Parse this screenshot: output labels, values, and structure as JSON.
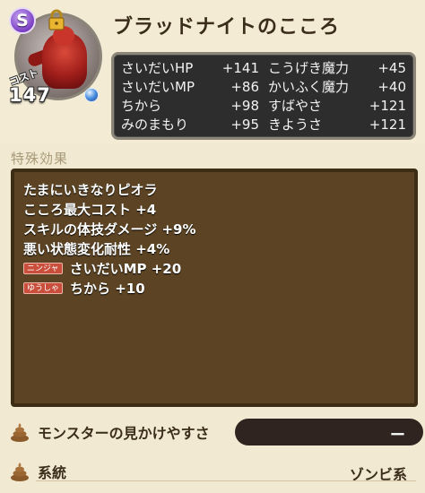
{
  "header": {
    "title": "ブラッドナイトのこころ",
    "rank": "S",
    "cost_label": "コスト",
    "cost_value": "147"
  },
  "stats": [
    {
      "label": "さいだいHP",
      "value": "+141"
    },
    {
      "label": "こうげき魔力",
      "value": "+45"
    },
    {
      "label": "さいだいMP",
      "value": "+86"
    },
    {
      "label": "かいふく魔力",
      "value": "+40"
    },
    {
      "label": "ちから",
      "value": "+98"
    },
    {
      "label": "すばやさ",
      "value": "+121"
    },
    {
      "label": "みのまもり",
      "value": "+95"
    },
    {
      "label": "きようさ",
      "value": "+121"
    }
  ],
  "effects_section": {
    "label": "特殊効果",
    "items": [
      {
        "text": "たまにいきなりピオラ",
        "tag": ""
      },
      {
        "text": "こころ最大コスト +4",
        "tag": ""
      },
      {
        "text": "スキルの体技ダメージ +9%",
        "tag": ""
      },
      {
        "text": "悪い状態変化耐性 +4%",
        "tag": ""
      },
      {
        "text": "さいだいMP +20",
        "tag": "ニンジャ"
      },
      {
        "text": "ちから +10",
        "tag": "ゆうしゃ"
      }
    ]
  },
  "bottom": {
    "visibility_label": "モンスターの見かけやすさ",
    "visibility_value": "ー",
    "family_label": "系統",
    "family_value": "ゾンビ系"
  },
  "icons": {
    "rank": "rank-s-badge-icon",
    "lock": "lock-icon",
    "orb": "blue-orb-icon",
    "row": "poop-icon"
  },
  "colors": {
    "background": "#f1e9d1",
    "stats_box": "#2d2d2d",
    "effects_box": "#5b4323",
    "rank_badge": "#7b3fc4"
  }
}
